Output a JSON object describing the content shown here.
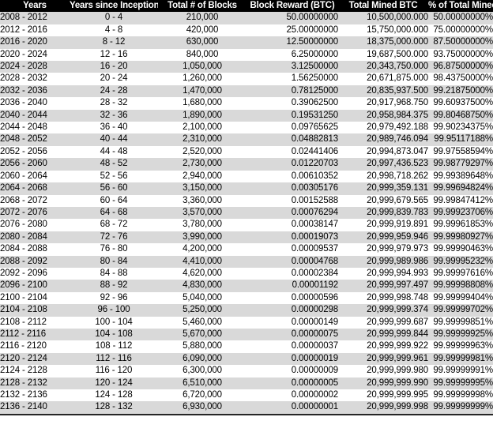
{
  "table": {
    "columns": [
      {
        "key": "years",
        "label": "Years",
        "class": "c-years"
      },
      {
        "key": "since",
        "label": "Years since Inception",
        "class": "c-since"
      },
      {
        "key": "blocks",
        "label": "Total # of Blocks",
        "class": "c-blocks"
      },
      {
        "key": "reward",
        "label": "Block Reward (BTC)",
        "class": "c-reward"
      },
      {
        "key": "mined",
        "label": "Total Mined BTC",
        "class": "c-mined"
      },
      {
        "key": "pct",
        "label": "% of Total Mined",
        "class": "c-pct"
      }
    ],
    "header_bg": "#000000",
    "header_fg": "#ffffff",
    "band_color": "#d9d9d9",
    "rows": [
      [
        "2008 - 2012",
        "0 - 4",
        "210,000",
        "50.00000000",
        "10,500,000.000",
        "50.00000000%"
      ],
      [
        "2012 - 2016",
        "4 - 8",
        "420,000",
        "25.00000000",
        "15,750,000.000",
        "75.00000000%"
      ],
      [
        "2016 - 2020",
        "8 - 12",
        "630,000",
        "12.50000000",
        "18,375,000.000",
        "87.50000000%"
      ],
      [
        "2020 - 2024",
        "12 - 16",
        "840,000",
        "6.25000000",
        "19,687,500.000",
        "93.75000000%"
      ],
      [
        "2024 - 2028",
        "16 - 20",
        "1,050,000",
        "3.12500000",
        "20,343,750.000",
        "96.87500000%"
      ],
      [
        "2028 - 2032",
        "20 - 24",
        "1,260,000",
        "1.56250000",
        "20,671,875.000",
        "98.43750000%"
      ],
      [
        "2032 - 2036",
        "24 - 28",
        "1,470,000",
        "0.78125000",
        "20,835,937.500",
        "99.21875000%"
      ],
      [
        "2036 - 2040",
        "28 - 32",
        "1,680,000",
        "0.39062500",
        "20,917,968.750",
        "99.60937500%"
      ],
      [
        "2040 - 2044",
        "32 - 36",
        "1,890,000",
        "0.19531250",
        "20,958,984.375",
        "99.80468750%"
      ],
      [
        "2044 - 2048",
        "36 - 40",
        "2,100,000",
        "0.09765625",
        "20,979,492.188",
        "99.90234375%"
      ],
      [
        "2048 - 2052",
        "40 - 44",
        "2,310,000",
        "0.04882813",
        "20,989,746.094",
        "99.95117188%"
      ],
      [
        "2052 - 2056",
        "44 - 48",
        "2,520,000",
        "0.02441406",
        "20,994,873.047",
        "99.97558594%"
      ],
      [
        "2056 - 2060",
        "48 - 52",
        "2,730,000",
        "0.01220703",
        "20,997,436.523",
        "99.98779297%"
      ],
      [
        "2060 - 2064",
        "52 - 56",
        "2,940,000",
        "0.00610352",
        "20,998,718.262",
        "99.99389648%"
      ],
      [
        "2064 - 2068",
        "56 - 60",
        "3,150,000",
        "0.00305176",
        "20,999,359.131",
        "99.99694824%"
      ],
      [
        "2068 - 2072",
        "60 - 64",
        "3,360,000",
        "0.00152588",
        "20,999,679.565",
        "99.99847412%"
      ],
      [
        "2072 - 2076",
        "64 - 68",
        "3,570,000",
        "0.00076294",
        "20,999,839.783",
        "99.99923706%"
      ],
      [
        "2076 - 2080",
        "68 - 72",
        "3,780,000",
        "0.00038147",
        "20,999,919.891",
        "99.99961853%"
      ],
      [
        "2080 - 2084",
        "72 - 76",
        "3,990,000",
        "0.00019073",
        "20,999,959.946",
        "99.99980927%"
      ],
      [
        "2084 - 2088",
        "76 - 80",
        "4,200,000",
        "0.00009537",
        "20,999,979.973",
        "99.99990463%"
      ],
      [
        "2088 - 2092",
        "80 - 84",
        "4,410,000",
        "0.00004768",
        "20,999,989.986",
        "99.99995232%"
      ],
      [
        "2092 - 2096",
        "84 - 88",
        "4,620,000",
        "0.00002384",
        "20,999,994.993",
        "99.99997616%"
      ],
      [
        "2096 - 2100",
        "88 - 92",
        "4,830,000",
        "0.00001192",
        "20,999,997.497",
        "99.99998808%"
      ],
      [
        "2100 - 2104",
        "92 - 96",
        "5,040,000",
        "0.00000596",
        "20,999,998.748",
        "99.99999404%"
      ],
      [
        "2104 - 2108",
        "96 - 100",
        "5,250,000",
        "0.00000298",
        "20,999,999.374",
        "99.99999702%"
      ],
      [
        "2108 - 2112",
        "100 - 104",
        "5,460,000",
        "0.00000149",
        "20,999,999.687",
        "99.99999851%"
      ],
      [
        "2112 - 2116",
        "104 - 108",
        "5,670,000",
        "0.00000075",
        "20,999,999.844",
        "99.99999925%"
      ],
      [
        "2116 - 2120",
        "108 - 112",
        "5,880,000",
        "0.00000037",
        "20,999,999.922",
        "99.99999963%"
      ],
      [
        "2120 - 2124",
        "112 - 116",
        "6,090,000",
        "0.00000019",
        "20,999,999.961",
        "99.99999981%"
      ],
      [
        "2124 - 2128",
        "116 - 120",
        "6,300,000",
        "0.00000009",
        "20,999,999.980",
        "99.99999991%"
      ],
      [
        "2128 - 2132",
        "120 - 124",
        "6,510,000",
        "0.00000005",
        "20,999,999.990",
        "99.99999995%"
      ],
      [
        "2132 - 2136",
        "124 - 128",
        "6,720,000",
        "0.00000002",
        "20,999,999.995",
        "99.99999998%"
      ],
      [
        "2136 - 2140",
        "128 - 132",
        "6,930,000",
        "0.00000001",
        "20,999,999.998",
        "99.99999999%"
      ]
    ]
  }
}
